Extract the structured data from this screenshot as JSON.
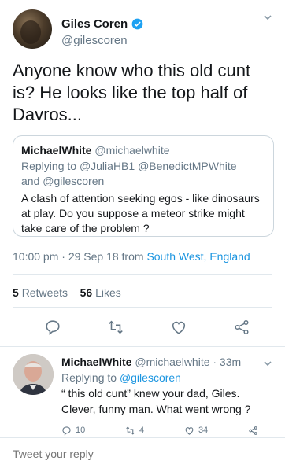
{
  "tweet": {
    "author_name": "Giles Coren",
    "author_handle": "@gilescoren",
    "text": "Anyone know who this old cunt is? He looks like the top half of Davros...",
    "quoted": {
      "author_name": "MichaelWhite",
      "author_handle": "@michaelwhite",
      "replying_label": "Replying to",
      "replying_handles": "@JuliaHB1 @BenedictMPWhite",
      "replying_and": "and",
      "replying_handle_last": "@gilescoren",
      "text": "A clash of attention seeking egos - like dinosaurs at play. Do you suppose a meteor strike might take care of the problem ?"
    },
    "timestamp": "10:00 pm · 29 Sep 18 from",
    "location": "South West, England",
    "retweets_count": "5",
    "retweets_label": "Retweets",
    "likes_count": "56",
    "likes_label": "Likes"
  },
  "reply": {
    "author_name": "MichaelWhite",
    "author_handle_time": "@michaelwhite · 33m",
    "replying_label": "Replying to",
    "replying_handle": "@gilescoren",
    "text": "“ this old cunt” knew your dad, Giles. Clever, funny man. What went wrong ?",
    "reply_count": "10",
    "retweet_count": "4",
    "like_count": "34"
  },
  "compose": {
    "placeholder": "Tweet your reply"
  },
  "icons": {
    "verified": "verified-badge-icon",
    "chevron": "chevron-down-icon",
    "reply": "reply-icon",
    "retweet": "retweet-icon",
    "like": "heart-icon",
    "share": "share-icon"
  },
  "colors": {
    "link": "#1b95e0",
    "muted": "#657786",
    "text": "#14171a"
  }
}
